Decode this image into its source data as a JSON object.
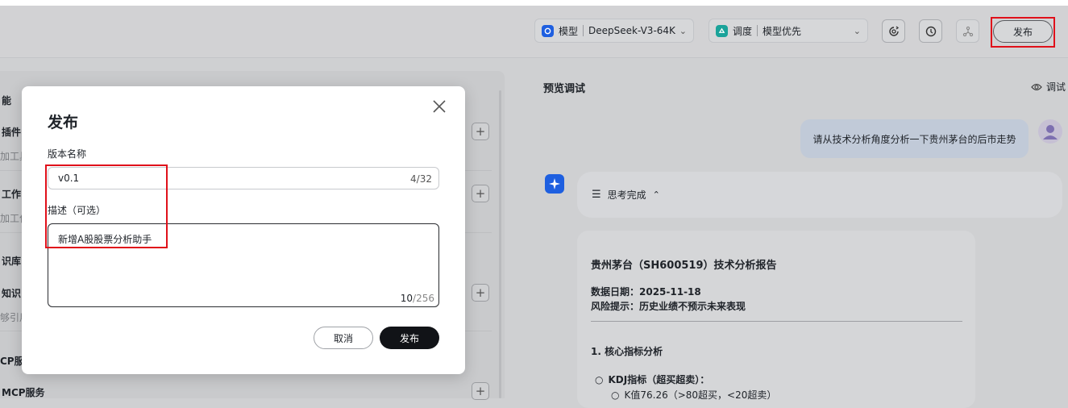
{
  "topbar": {
    "model": {
      "label": "模型",
      "value": "DeepSeek-V3-64K"
    },
    "schedule": {
      "label": "调度",
      "value": "模型优先"
    },
    "publish_label": "发布"
  },
  "left_panel": {
    "section1_title": "能",
    "plugin_title": "插件",
    "plugin_desc": "加工具",
    "workflow_title": "工作",
    "workflow_desc": "加工作",
    "kb_section": "识库",
    "kb_title": "知识",
    "kb_desc": "够引用",
    "mcp_section": "CP服",
    "mcp_title": "MCP服务"
  },
  "preview": {
    "title": "预览调试",
    "debug_label": "调试",
    "user_message": "请从技术分析角度分析一下贵州茅台的后市走势",
    "thinking_label": "思考完成",
    "report_title": "贵州茅台（SH600519）技术分析报告",
    "data_date": "数据日期：2025-11-18",
    "risk": "风险提示：历史业绩不预示未来表现",
    "section1": "1. 核心指标分析",
    "kdj": "KDJ指标（超买超卖）：",
    "kdj_detail": "K值76.26（>80超买，<20超卖）"
  },
  "modal": {
    "title": "发布",
    "version_label": "版本名称",
    "version_value": "v0.1",
    "version_count": "4/32",
    "desc_label": "描述（可选）",
    "desc_value": "新增A股股票分析助手",
    "desc_count_current": "10",
    "desc_count_max": "/256",
    "cancel_label": "取消",
    "publish_label": "发布"
  },
  "colors": {
    "accent": "#1e5fe0",
    "highlight": "#e0101a",
    "primary_button": "#111317"
  }
}
